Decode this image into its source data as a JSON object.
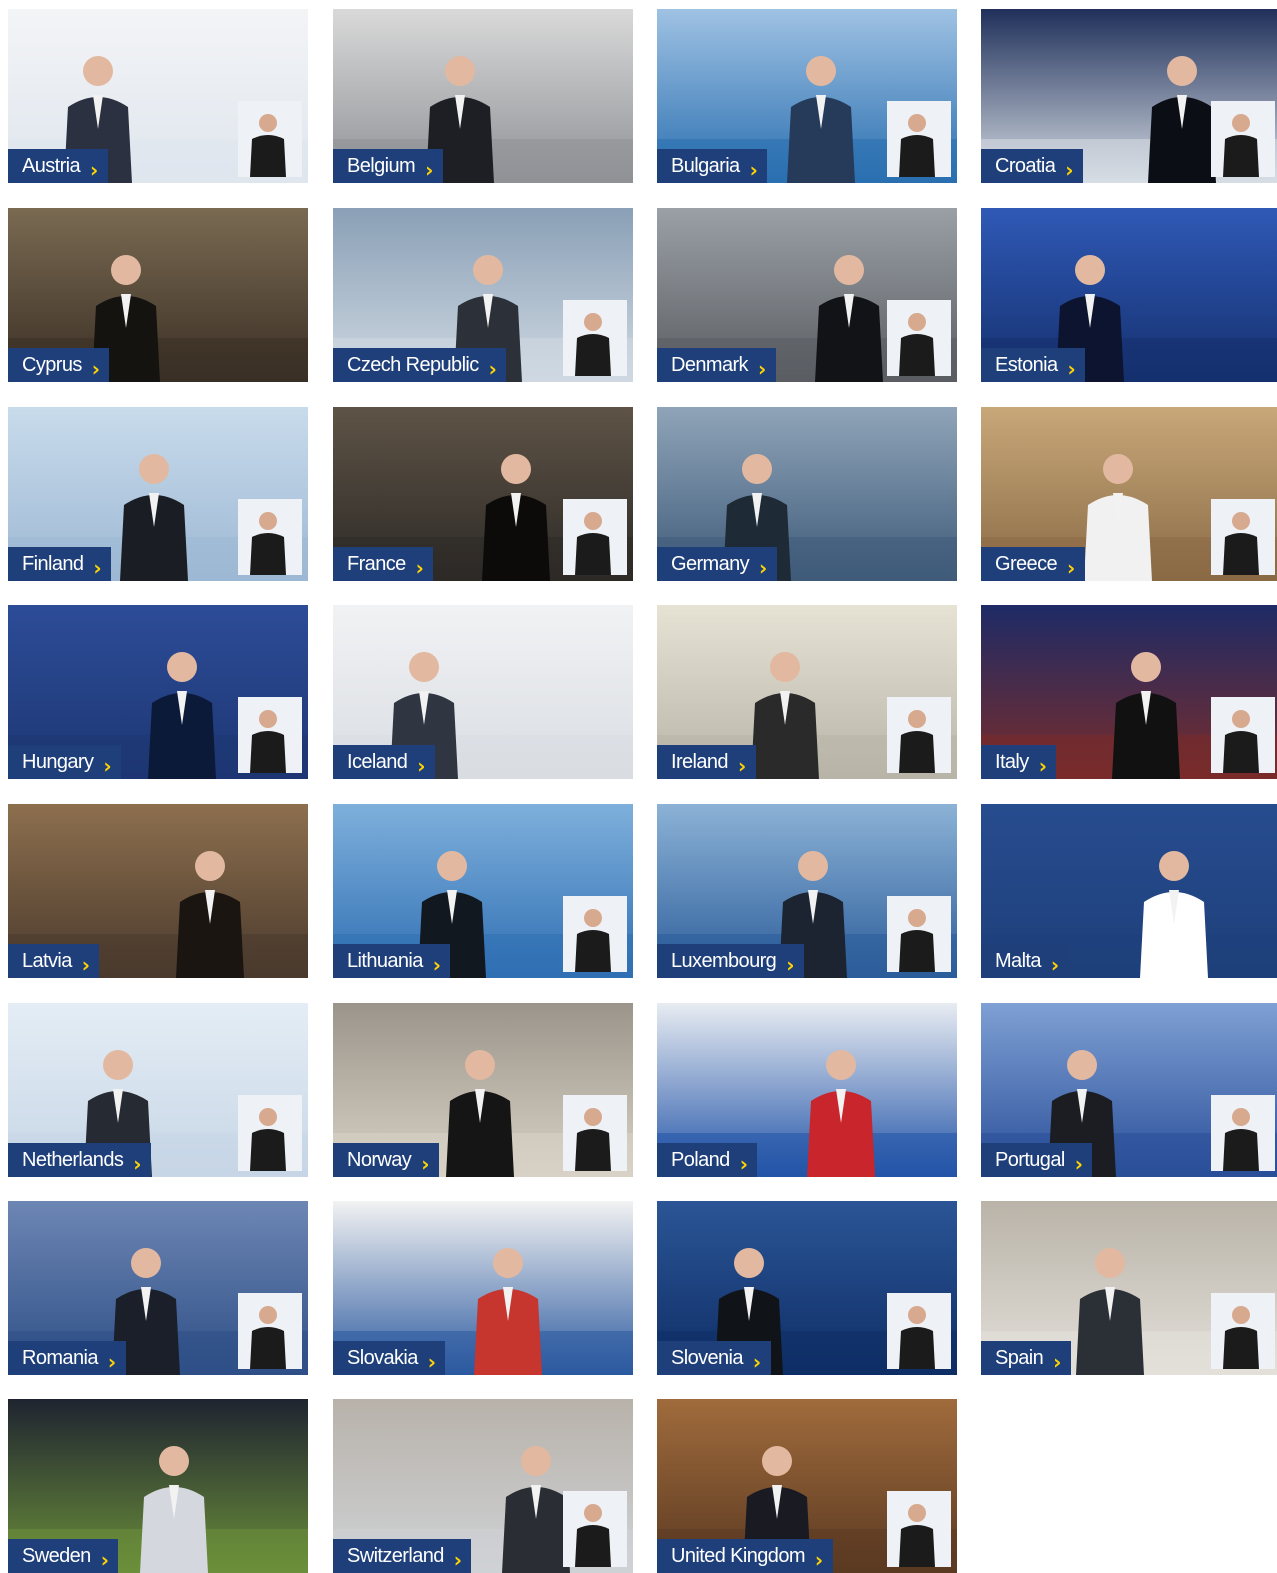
{
  "colors": {
    "label_bg": "#1e3f7a",
    "label_text": "#ffffff",
    "chevron": "#ffd400"
  },
  "chevron_icon": "chevron-right-icon",
  "countries": [
    {
      "name": "Austria"
    },
    {
      "name": "Belgium"
    },
    {
      "name": "Bulgaria"
    },
    {
      "name": "Croatia"
    },
    {
      "name": "Cyprus"
    },
    {
      "name": "Czech Republic"
    },
    {
      "name": "Denmark"
    },
    {
      "name": "Estonia"
    },
    {
      "name": "Finland"
    },
    {
      "name": "France"
    },
    {
      "name": "Germany"
    },
    {
      "name": "Greece"
    },
    {
      "name": "Hungary"
    },
    {
      "name": "Iceland"
    },
    {
      "name": "Ireland"
    },
    {
      "name": "Italy"
    },
    {
      "name": "Latvia"
    },
    {
      "name": "Lithuania"
    },
    {
      "name": "Luxembourg"
    },
    {
      "name": "Malta"
    },
    {
      "name": "Netherlands"
    },
    {
      "name": "Norway"
    },
    {
      "name": "Poland"
    },
    {
      "name": "Portugal"
    },
    {
      "name": "Romania"
    },
    {
      "name": "Slovakia"
    },
    {
      "name": "Slovenia"
    },
    {
      "name": "Spain"
    },
    {
      "name": "Sweden"
    },
    {
      "name": "Switzerland"
    },
    {
      "name": "United Kingdom"
    }
  ]
}
